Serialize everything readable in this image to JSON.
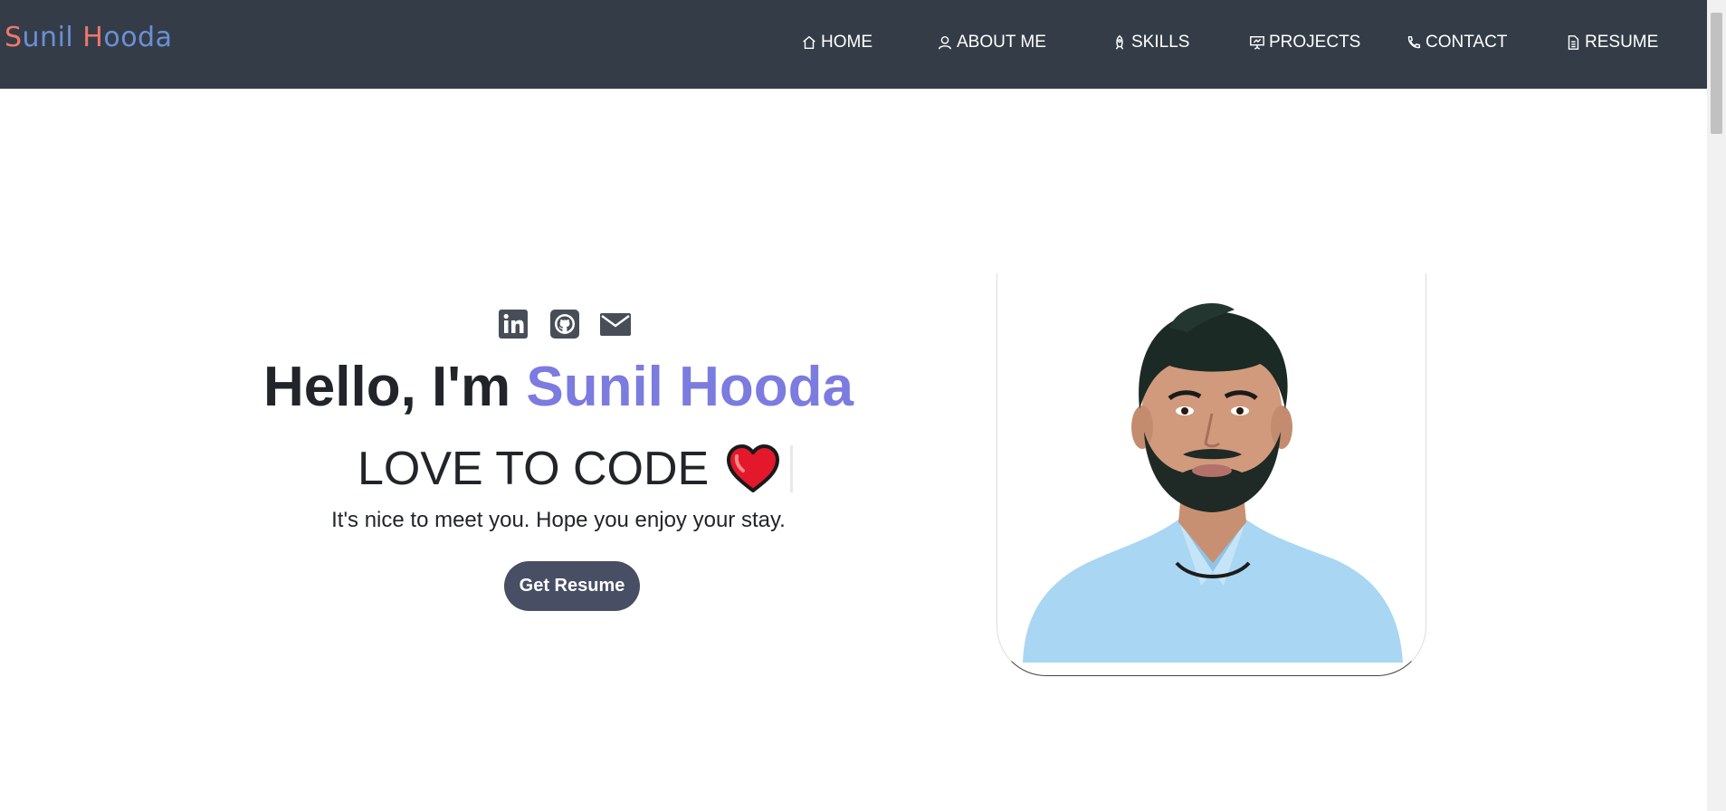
{
  "brand": {
    "first_initial": "S",
    "first_rest": "unil ",
    "last_initial": "H",
    "last_rest": "ooda"
  },
  "nav": {
    "items": [
      {
        "label": "HOME",
        "icon": "home-icon"
      },
      {
        "label": "ABOUT ME",
        "icon": "user-icon"
      },
      {
        "label": "SKILLS",
        "icon": "rocket-icon"
      },
      {
        "label": "PROJECTS",
        "icon": "presentation-icon"
      },
      {
        "label": "CONTACT",
        "icon": "phone-icon"
      },
      {
        "label": "RESUME",
        "icon": "document-icon"
      }
    ]
  },
  "socials": [
    {
      "icon": "linkedin-icon"
    },
    {
      "icon": "github-icon"
    },
    {
      "icon": "mail-icon"
    }
  ],
  "hero": {
    "greeting": "Hello, I'm ",
    "name": "Sunil Hooda",
    "tagline": "LOVE TO CODE",
    "tagline_icon": "heart-icon",
    "subtitle": "It's nice to meet you. Hope you enjoy your stay.",
    "button_label": "Get Resume"
  },
  "colors": {
    "navbar_bg": "#343d47",
    "brand_initial": "#f2766b",
    "brand_rest": "#6c8fd6",
    "name_accent": "#7b7be0",
    "button_bg": "#484e63",
    "heart": "#e3182b"
  }
}
